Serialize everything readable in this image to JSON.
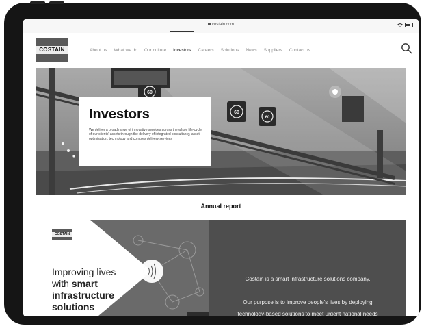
{
  "browser": {
    "url": "costain.com"
  },
  "site": {
    "logo_text": "COSTAIN"
  },
  "nav": {
    "items": [
      {
        "label": "About us",
        "active": false
      },
      {
        "label": "What we do",
        "active": false
      },
      {
        "label": "Our culture",
        "active": false
      },
      {
        "label": "Investors",
        "active": true
      },
      {
        "label": "Careers",
        "active": false
      },
      {
        "label": "Solutions",
        "active": false
      },
      {
        "label": "News",
        "active": false
      },
      {
        "label": "Suppliers",
        "active": false
      },
      {
        "label": "Contact us",
        "active": false
      }
    ]
  },
  "hero": {
    "title": "Investors",
    "description": "We deliver a broad range of innovative services across the whole life-cycle of our clients' assets through the delivery of integrated consultancy, asset optimisation, technology and complex delivery services",
    "signs": [
      "60",
      "60",
      "60"
    ]
  },
  "annual_report": {
    "heading": "Annual report",
    "mini_logo": "COSTAIN",
    "slogan_line1": "Improving lives",
    "slogan_line2_prefix": "with ",
    "slogan_line2_bold": "smart",
    "slogan_line3": "infrastructure",
    "slogan_line4": "solutions",
    "right_line1": "Costain is a smart infrastructure solutions company.",
    "right_line2": "Our purpose is to improve people's lives by deploying",
    "right_line3": "technology-based solutions to meet urgent national needs"
  },
  "icons": {
    "search": "search-icon",
    "lock": "lock-icon",
    "wifi": "wifi-icon",
    "battery": "battery-icon"
  },
  "colors": {
    "device": "#151515",
    "report_dark": "#4e4e4e",
    "hero_gray": "#8c8c8c"
  }
}
